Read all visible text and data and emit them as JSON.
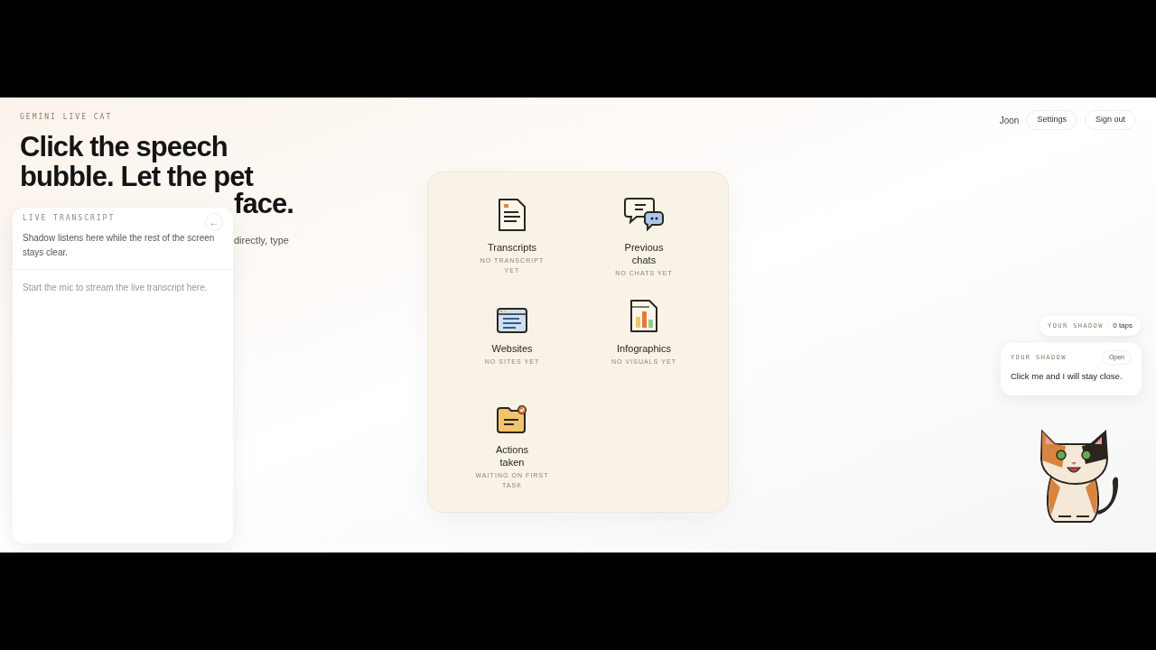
{
  "brand": "GEMINI LIVE CAT",
  "headline": "Click the speech bubble. Let the pet",
  "headline_tail": "face.",
  "subtitle": "directly, type",
  "nav": {
    "user": "Joon",
    "buttons": [
      "Settings",
      "Sign out"
    ]
  },
  "transcript": {
    "title": "LIVE TRANSCRIPT",
    "back": "←",
    "intro": "Shadow listens here while the rest of the screen stays clear.",
    "empty": "Start the mic to stream the live transcript here."
  },
  "tiles": [
    {
      "kind": "transcript",
      "title": "Transcripts",
      "status": "NO TRANSCRIPT YET"
    },
    {
      "kind": "chats",
      "title": "Previous chats",
      "status": "NO CHATS YET"
    },
    {
      "kind": "websites",
      "title": "Websites",
      "status": "NO SITES YET"
    },
    {
      "kind": "infographics",
      "title": "Infographics",
      "status": "NO VISUALS YET"
    },
    {
      "kind": "actions",
      "title": "Actions taken",
      "status": "WAITING ON FIRST TASK"
    }
  ],
  "shadow": {
    "pill_label": "YOUR SHADOW",
    "separator": "·",
    "taps": "0 taps",
    "bubble_label": "YOUR SHADOW",
    "open": "Open",
    "message": "Click me and I will stay close."
  }
}
